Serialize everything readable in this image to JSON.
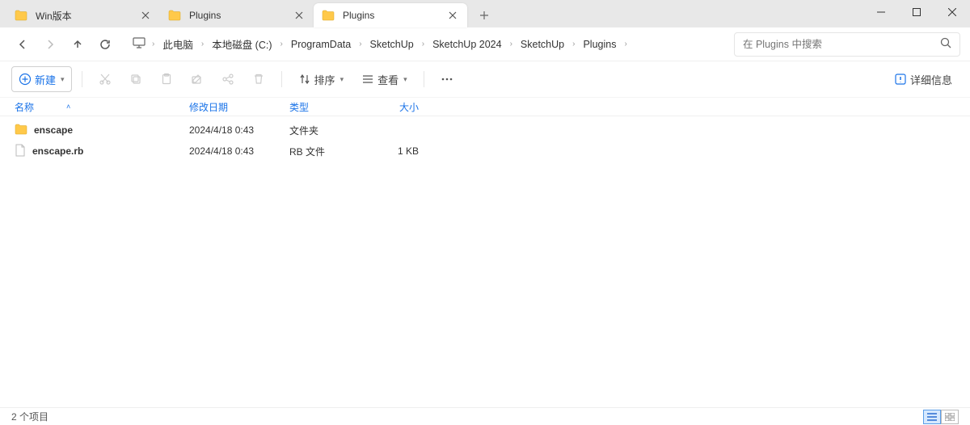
{
  "tabs": [
    {
      "label": "Win版本",
      "active": false
    },
    {
      "label": "Plugins",
      "active": false
    },
    {
      "label": "Plugins",
      "active": true
    }
  ],
  "breadcrumb": {
    "items": [
      "此电脑",
      "本地磁盘 (C:)",
      "ProgramData",
      "SketchUp",
      "SketchUp 2024",
      "SketchUp",
      "Plugins"
    ]
  },
  "search": {
    "placeholder": "在 Plugins 中搜索"
  },
  "toolbar": {
    "new_label": "新建",
    "sort_label": "排序",
    "view_label": "查看",
    "details_label": "详细信息"
  },
  "columns": {
    "name": "名称",
    "date": "修改日期",
    "type": "类型",
    "size": "大小"
  },
  "files": [
    {
      "name": "enscape",
      "date": "2024/4/18 0:43",
      "type": "文件夹",
      "size": "",
      "isFolder": true
    },
    {
      "name": "enscape.rb",
      "date": "2024/4/18 0:43",
      "type": "RB 文件",
      "size": "1 KB",
      "isFolder": false
    }
  ],
  "statusbar": {
    "count_text": "2 个项目"
  }
}
